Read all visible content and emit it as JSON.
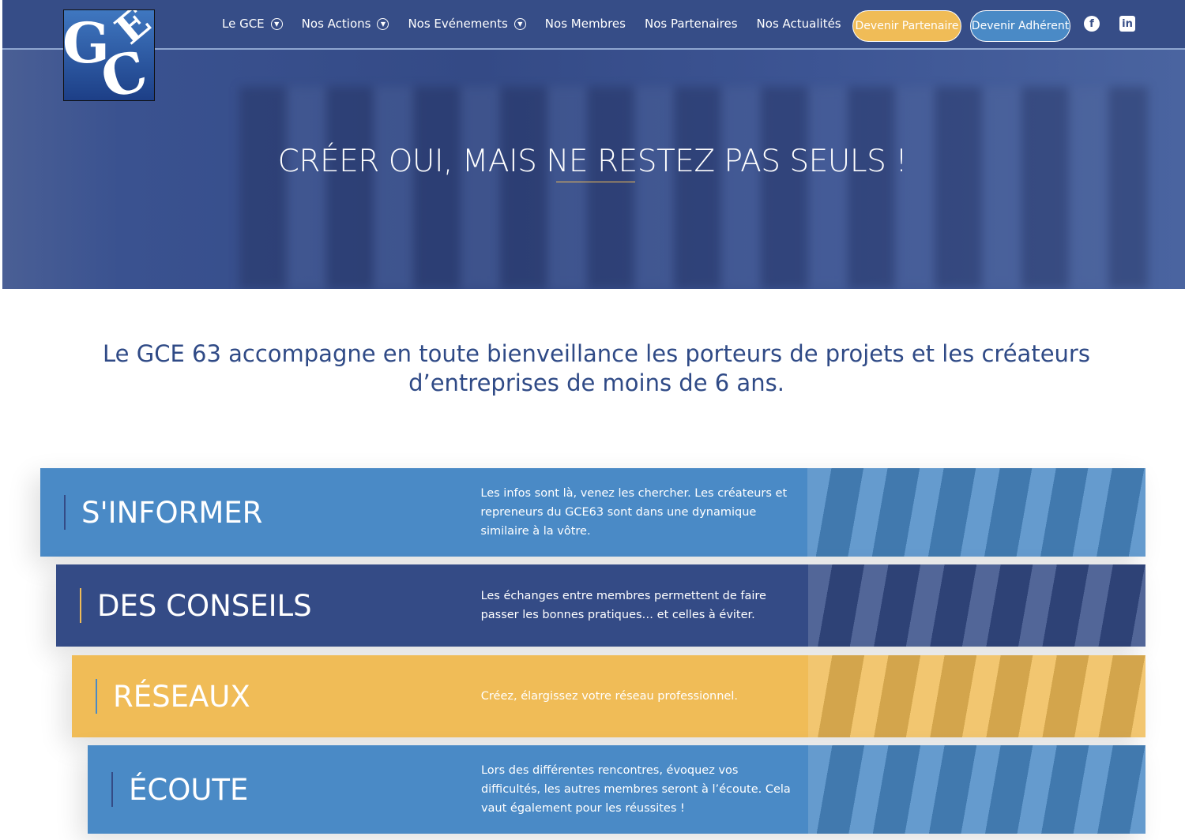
{
  "nav": {
    "logo": "GCE",
    "menu": [
      {
        "label": "Le GCE",
        "dropdown": true
      },
      {
        "label": "Nos Actions",
        "dropdown": true
      },
      {
        "label": "Nos Evénements",
        "dropdown": true
      },
      {
        "label": "Nos Membres"
      },
      {
        "label": "Nos Partenaires"
      },
      {
        "label": "Nos Actualités"
      }
    ],
    "partner_btn": "Devenir Partenaire",
    "member_btn": "Devenir Adhérent",
    "icons": [
      "facebook-icon",
      "linkedin-icon"
    ]
  },
  "hero": {
    "title": "CRÉER OUI, MAIS NE RESTEZ PAS SEULS !"
  },
  "intro": "Le GCE 63 accompagne en toute bienveillance les porteurs de projets et les créateurs d’entreprises de moins de 6 ans.",
  "rows": [
    {
      "title": "S'INFORMER",
      "text": "Les infos sont là, venez les chercher. Les créateurs et repreneurs du GCE63 sont dans une dynamique similaire à la vôtre.",
      "color": "#4a8ac6"
    },
    {
      "title": "DES CONSEILS",
      "text": "Les échanges entre membres permettent de faire passer les bonnes pratiques… et celles à éviter.",
      "color": "#344b86"
    },
    {
      "title": "RÉSEAUX",
      "text": "Créez, élargissez votre réseau professionnel.",
      "color": "#f0bc57"
    },
    {
      "title": "ÉCOUTE",
      "text": "Lors des différentes rencontres, évoquez vos difficultés, les autres membres seront à l’écoute. Cela vaut également pour les réussites !",
      "color": "#4a8ac6"
    }
  ]
}
